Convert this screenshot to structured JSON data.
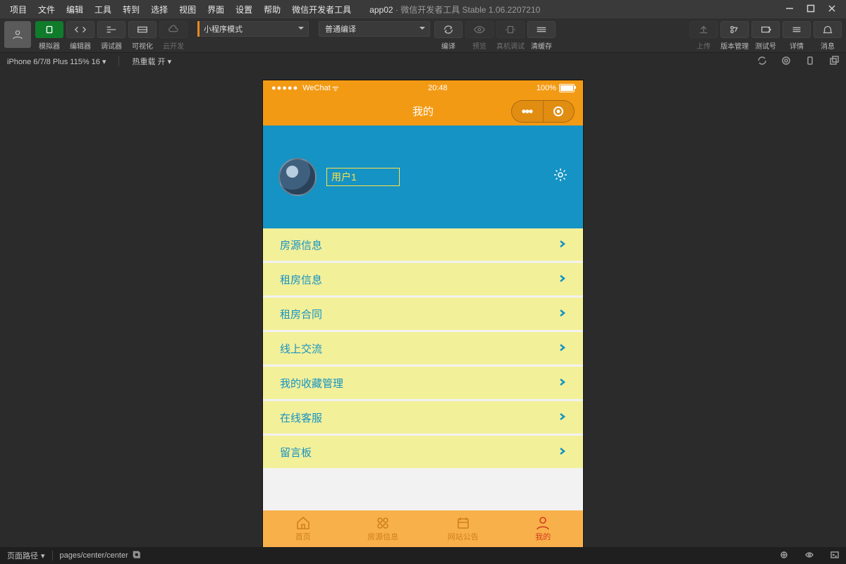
{
  "window": {
    "app_name": "app02",
    "app_suffix": " · 微信开发者工具 Stable 1.06.2207210"
  },
  "menu": [
    "项目",
    "文件",
    "编辑",
    "工具",
    "转到",
    "选择",
    "视图",
    "界面",
    "设置",
    "帮助",
    "微信开发者工具"
  ],
  "toolbar": {
    "labels": {
      "simulator": "模拟器",
      "editor": "编辑器",
      "debugger": "调试器",
      "visual": "可视化",
      "cloud": "云开发"
    },
    "mode_select": "小程序模式",
    "compile_select": "普通编译",
    "actions": {
      "compile": "编译",
      "preview": "预览",
      "remote": "真机调试",
      "clear": "清缓存"
    },
    "right": {
      "upload": "上传",
      "version": "版本管理",
      "testid": "测试号",
      "detail": "详情",
      "message": "消息"
    }
  },
  "devicebar": {
    "device": "iPhone 6/7/8 Plus 115% 16",
    "hotreload": "热重载 开"
  },
  "phone": {
    "status": {
      "carrier": "WeChat",
      "time": "20:48",
      "battery": "100%"
    },
    "nav_title": "我的",
    "username": "用户1",
    "menu_items": [
      "房源信息",
      "租房信息",
      "租房合同",
      "线上交流",
      "我的收藏管理",
      "在线客服",
      "留言板"
    ],
    "tabs": [
      "首页",
      "房源信息",
      "网站公告",
      "我的"
    ]
  },
  "statusbar": {
    "label": "页面路径",
    "path": "pages/center/center"
  }
}
